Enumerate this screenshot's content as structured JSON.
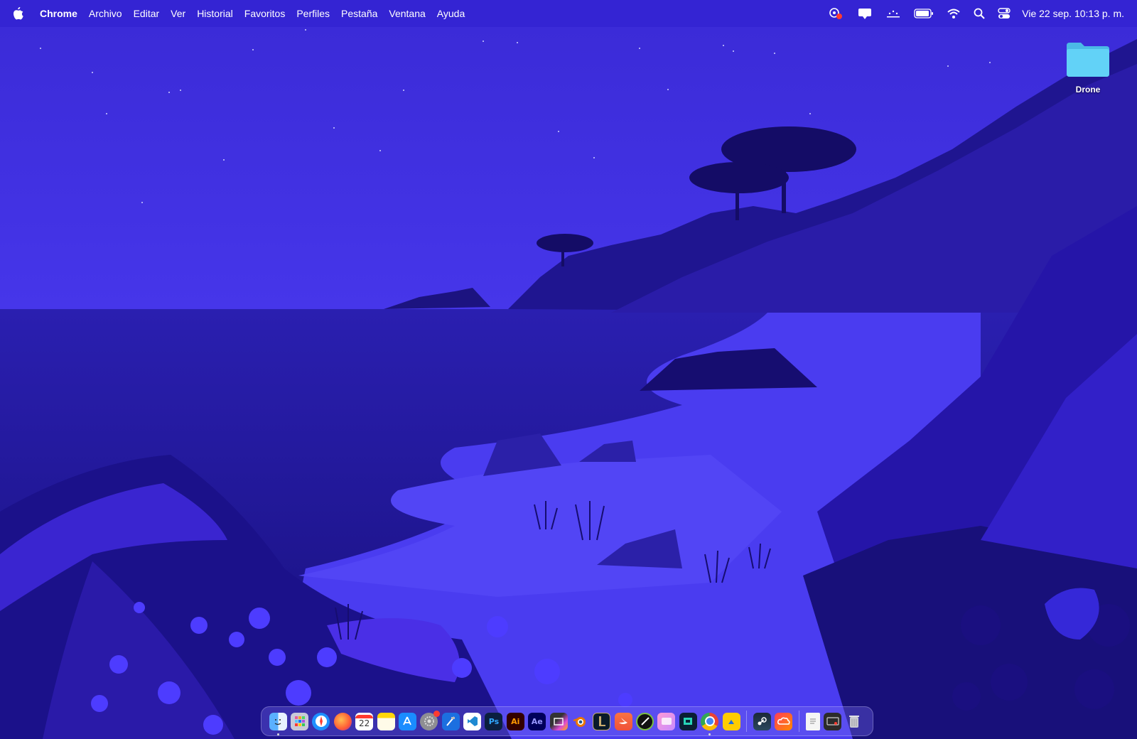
{
  "menubar": {
    "app_name": "Chrome",
    "menus": [
      "Archivo",
      "Editar",
      "Ver",
      "Historial",
      "Favoritos",
      "Perfiles",
      "Pestaña",
      "Ventana",
      "Ayuda"
    ],
    "clock": "Vie 22 sep.  10:13 p. m.",
    "status_icons": [
      "screen-recording-icon",
      "notification-icon",
      "stage-icon",
      "battery-icon",
      "wifi-icon",
      "spotlight-search-icon",
      "control-center-icon"
    ]
  },
  "desktop": {
    "folder_label": "Drone"
  },
  "dock": {
    "calendar_day": "22",
    "photoshop_label": "Ps",
    "illustrator_label": "Ai",
    "aftereffects_label": "Ae",
    "apps": [
      "finder",
      "launchpad",
      "safari",
      "firefox",
      "calendar",
      "notes",
      "app-store",
      "system-settings",
      "xcode",
      "vscode",
      "photoshop",
      "illustrator",
      "after-effects",
      "final-cut-pro",
      "blender",
      "league-of-legends",
      "swift-playgrounds",
      "inkscape",
      "pixelmator",
      "multipass",
      "chrome",
      "keynote",
      "steam",
      "creative-cloud",
      "document",
      "screen-capture",
      "trash"
    ]
  },
  "colors": {
    "sky": "#3f2fd6",
    "menubar": "#3424d2",
    "folder": "#5fd0f5"
  }
}
